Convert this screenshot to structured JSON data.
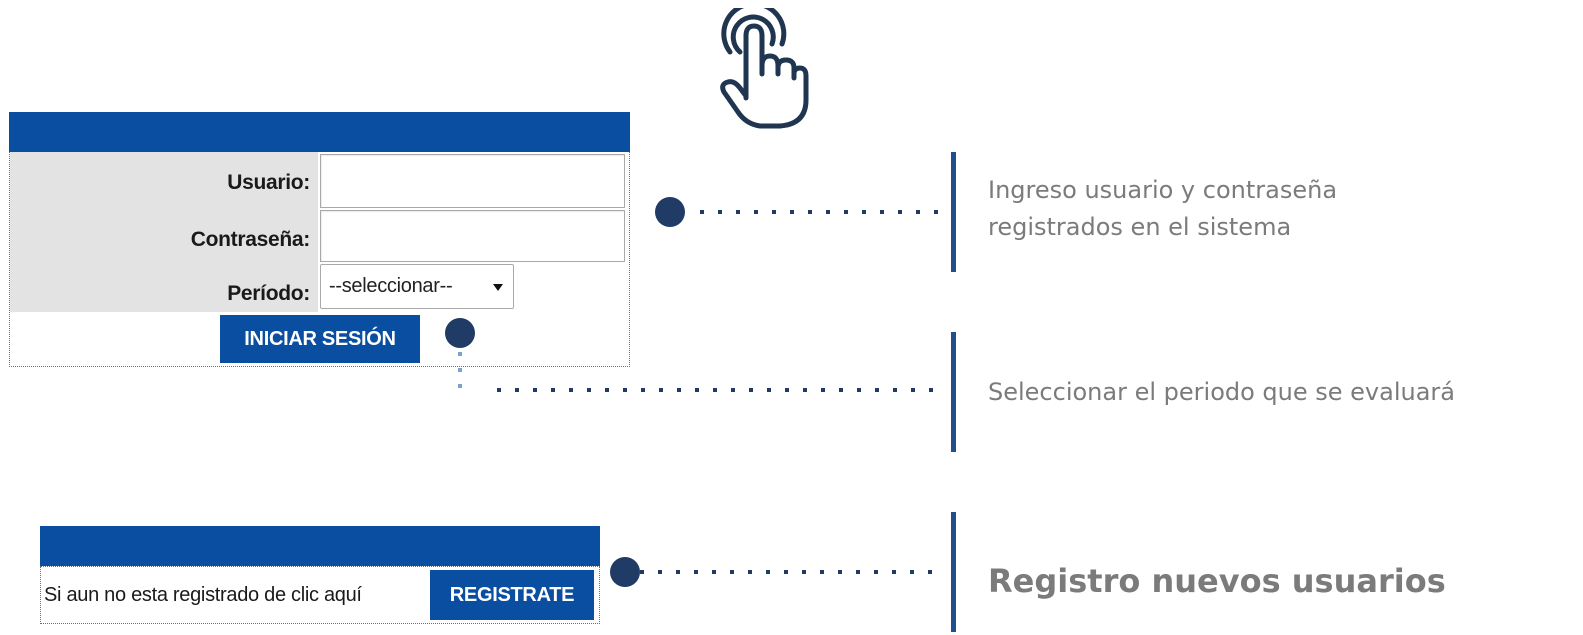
{
  "icons": {
    "hand": "pointer-hand-icon"
  },
  "login": {
    "user_label": "Usuario:",
    "user_value": "",
    "password_label": "Contraseña:",
    "password_value": "",
    "period_label": "Período:",
    "period_selected": "--seleccionar--",
    "submit_label": "INICIAR SESIÓN"
  },
  "register": {
    "prompt": "Si aun no esta registrado de clic aquí",
    "button_label": "REGISTRATE"
  },
  "annotations": {
    "credentials_line1": "Ingreso usuario y contraseña",
    "credentials_line2": "registrados en el sistema",
    "period": "Seleccionar el periodo que se evaluará",
    "register": "Registro nuevos usuarios"
  },
  "colors": {
    "brand_blue": "#0a4ea1",
    "label_bg": "#e3e3e3",
    "annotation_dot": "#1f3b66",
    "annotation_bar": "#1f4f8f",
    "annotation_text": "#7b7b7b"
  }
}
